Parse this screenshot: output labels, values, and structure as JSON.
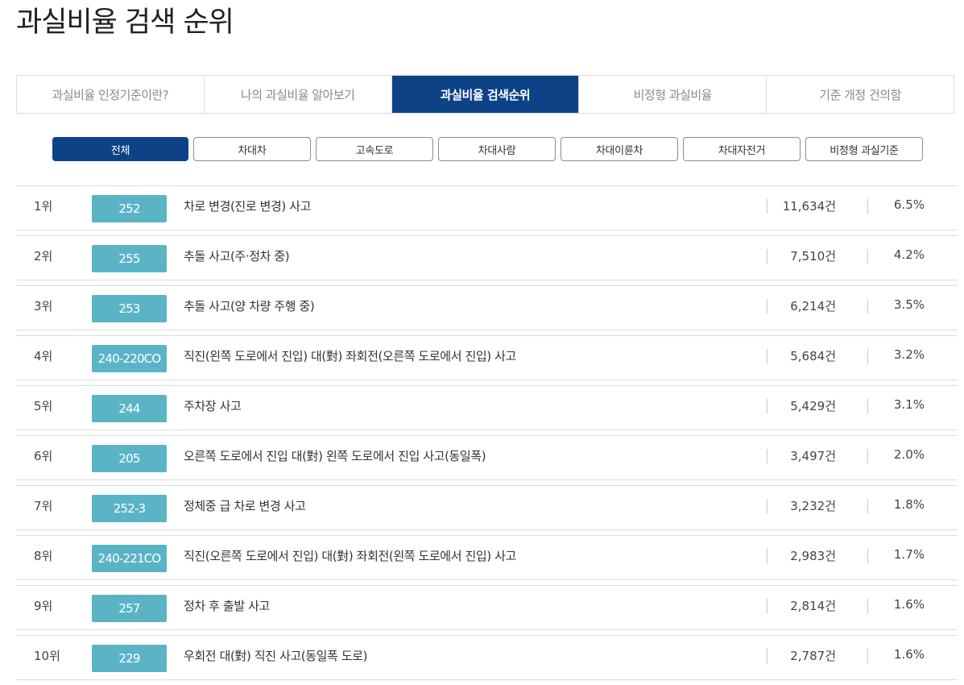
{
  "page": {
    "title": "과실비율 검색 순위"
  },
  "main_tabs": [
    {
      "label": "과실비율 인정기준이란?"
    },
    {
      "label": "나의 과실비율 알아보기"
    },
    {
      "label": "과실비율 검색순위"
    },
    {
      "label": "비정형 과실비율"
    },
    {
      "label": "기준 개정 건의함"
    }
  ],
  "active_main_tab": "과실비율 검색순위",
  "filters": [
    {
      "label": "전체"
    },
    {
      "label": "차대차"
    },
    {
      "label": "고속도로"
    },
    {
      "label": "차대사람"
    },
    {
      "label": "차대이륜차"
    },
    {
      "label": "차대자전거"
    },
    {
      "label": "비정형 과실기준"
    }
  ],
  "active_filter": "전체",
  "rankings": [
    {
      "rank": "1위",
      "code": "252",
      "title": "차로 변경(진로 변경) 사고",
      "count": "11,634건",
      "ratio": "6.5%"
    },
    {
      "rank": "2위",
      "code": "255",
      "title": "추돌 사고(주·정차 중)",
      "count": "7,510건",
      "ratio": "4.2%"
    },
    {
      "rank": "3위",
      "code": "253",
      "title": "추돌 사고(양 차량 주행 중)",
      "count": "6,214건",
      "ratio": "3.5%"
    },
    {
      "rank": "4위",
      "code": "240-220CO",
      "title": "직진(왼쪽 도로에서 진입) 대(對) 좌회전(오른쪽 도로에서 진입) 사고",
      "count": "5,684건",
      "ratio": "3.2%"
    },
    {
      "rank": "5위",
      "code": "244",
      "title": "주차장 사고",
      "count": "5,429건",
      "ratio": "3.1%"
    },
    {
      "rank": "6위",
      "code": "205",
      "title": "오른쪽 도로에서 진입 대(對) 왼쪽 도로에서 진입 사고(동일폭)",
      "count": "3,497건",
      "ratio": "2.0%"
    },
    {
      "rank": "7위",
      "code": "252-3",
      "title": "정체중 급 차로 변경 사고",
      "count": "3,232건",
      "ratio": "1.8%"
    },
    {
      "rank": "8위",
      "code": "240-221CO",
      "title": "직진(오른쪽 도로에서 진입) 대(對) 좌회전(왼쪽 도로에서 진입) 사고",
      "count": "2,983건",
      "ratio": "1.7%"
    },
    {
      "rank": "9위",
      "code": "257",
      "title": "정차 후 출발 사고",
      "count": "2,814건",
      "ratio": "1.6%"
    },
    {
      "rank": "10위",
      "code": "229",
      "title": "우회전 대(對) 직진 사고(동일폭 도로)",
      "count": "2,787건",
      "ratio": "1.6%"
    }
  ],
  "colors": {
    "primary": "#0d4287",
    "badge": "#5ab4c6",
    "border": "#dcdcdc"
  }
}
